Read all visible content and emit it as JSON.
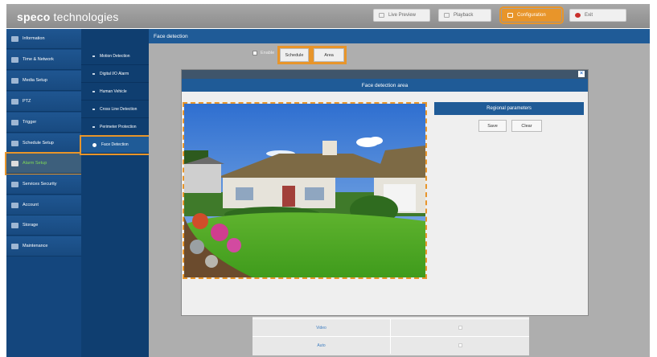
{
  "header": {
    "logo_bold": "speco",
    "logo_thin": " technologies",
    "buttons": {
      "live_preview": "Live Preview",
      "playback": "Playback",
      "configuration": "Configuration",
      "exit": "Exit"
    },
    "accent_color": "#e8952a"
  },
  "sidebar": {
    "items": [
      {
        "label": "Information",
        "icon": "info-icon"
      },
      {
        "label": "Time & Network",
        "icon": "network-icon"
      },
      {
        "label": "Media Setup",
        "icon": "media-icon"
      },
      {
        "label": "PTZ",
        "icon": "ptz-icon"
      },
      {
        "label": "Trigger",
        "icon": "trigger-icon"
      },
      {
        "label": "Schedule Setup",
        "icon": "calendar-icon"
      },
      {
        "label": "Alarm Setup",
        "icon": "alarm-icon",
        "active": true
      },
      {
        "label": "Services Security",
        "icon": "wrench-icon"
      },
      {
        "label": "Account",
        "icon": "monitor-icon"
      },
      {
        "label": "Storage",
        "icon": "storage-icon"
      },
      {
        "label": "Maintenance",
        "icon": "wrench-icon"
      }
    ]
  },
  "subbar": {
    "items": [
      {
        "label": "Motion Detection"
      },
      {
        "label": "Digital I/O Alarm"
      },
      {
        "label": "Human Vehicle"
      },
      {
        "label": "Cross Line Detection"
      },
      {
        "label": "Perimeter Protection"
      },
      {
        "label": "Face Detection",
        "active": true
      }
    ]
  },
  "content": {
    "title": "Face detection",
    "enable_label": "Enable",
    "schedule_label": "Schedule",
    "area_label": "Area",
    "table_rows": [
      {
        "c1": "Video",
        "c2_checked": false
      },
      {
        "c1": "Auto",
        "c2_checked": false
      }
    ]
  },
  "modal": {
    "close_glyph": "×",
    "title": "Face detection area",
    "regional_title": "Regional parameters",
    "save_label": "Save",
    "clear_label": "Clear"
  }
}
